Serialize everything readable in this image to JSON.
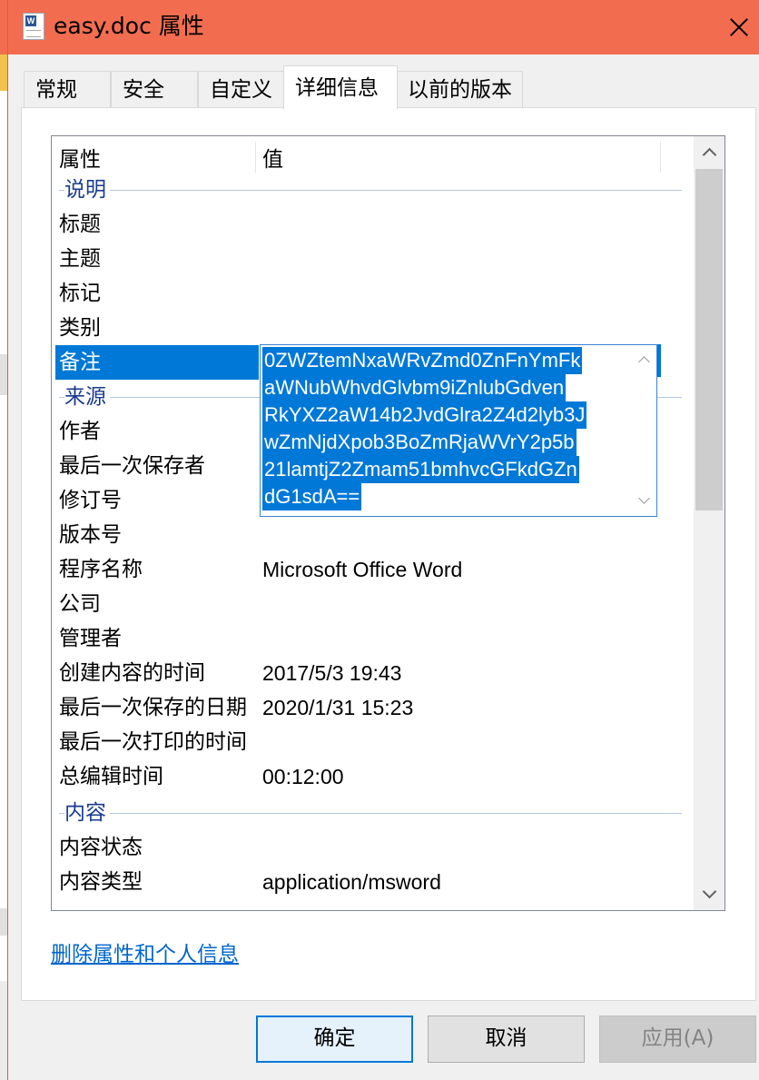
{
  "window": {
    "title": "easy.doc 属性",
    "icon": "word-document-icon",
    "close_icon": "close-icon"
  },
  "tabs": [
    {
      "label": "常规",
      "active": false
    },
    {
      "label": "安全",
      "active": false
    },
    {
      "label": "自定义",
      "active": false
    },
    {
      "label": "详细信息",
      "active": true
    },
    {
      "label": "以前的版本",
      "active": false
    }
  ],
  "table": {
    "header_property": "属性",
    "header_value": "值",
    "groups": {
      "description": "说明",
      "origin": "来源",
      "content": "内容"
    },
    "rows": {
      "title": {
        "label": "标题",
        "value": ""
      },
      "subject": {
        "label": "主题",
        "value": ""
      },
      "tags": {
        "label": "标记",
        "value": ""
      },
      "category": {
        "label": "类别",
        "value": ""
      },
      "comments": {
        "label": "备注",
        "value": ""
      },
      "author": {
        "label": "作者",
        "value": ""
      },
      "last_saved_by": {
        "label": "最后一次保存者",
        "value": ""
      },
      "revision": {
        "label": "修订号",
        "value": ""
      },
      "version": {
        "label": "版本号",
        "value": ""
      },
      "program": {
        "label": "程序名称",
        "value": "Microsoft Office Word"
      },
      "company": {
        "label": "公司",
        "value": ""
      },
      "manager": {
        "label": "管理者",
        "value": ""
      },
      "created": {
        "label": "创建内容的时间",
        "value": "2017/5/3 19:43"
      },
      "last_saved": {
        "label": "最后一次保存的日期",
        "value": "2020/1/31 15:23"
      },
      "last_printed": {
        "label": "最后一次打印的时间",
        "value": ""
      },
      "edit_time": {
        "label": "总编辑时间",
        "value": "00:12:00"
      },
      "content_status": {
        "label": "内容状态",
        "value": ""
      },
      "content_type": {
        "label": "内容类型",
        "value": "application/msword"
      }
    },
    "comments_edit_lines": [
      "0ZWZtemNxaWRvZmd0ZnFnYmFk",
      "aWNubWhvdGlvbm9iZnlubGdven",
      "RkYXZ2aW14b2JvdGlra2Z4d2lyb3J",
      "wZmNjdXpob3BoZmRjaWVrY2p5b",
      "21lamtjZ2Zmam51bmhvcGFkdGZn",
      "dG1sdA=="
    ]
  },
  "remove_link": "删除属性和个人信息",
  "buttons": {
    "ok": "确定",
    "cancel": "取消",
    "apply": "应用(A)"
  }
}
